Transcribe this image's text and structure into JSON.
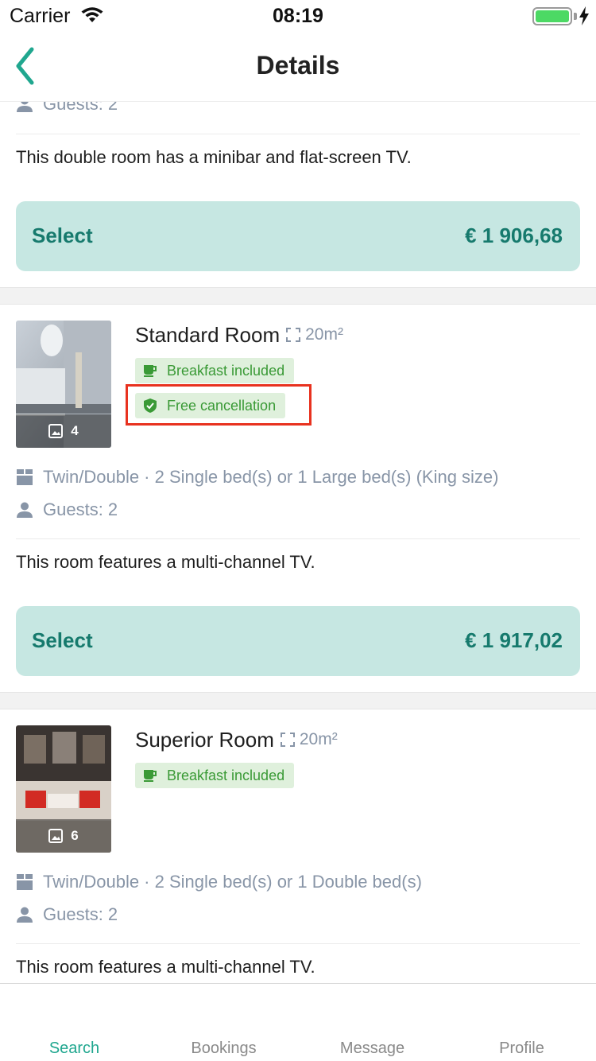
{
  "status_bar": {
    "carrier": "Carrier",
    "time": "08:19"
  },
  "nav": {
    "title": "Details"
  },
  "top_partial": {
    "guests": "Guests: 2",
    "description": "This double room has a minibar and flat-screen TV.",
    "select_label": "Select",
    "price": "€ 1 906,68"
  },
  "rooms": [
    {
      "name": "Standard Room",
      "size": "20m²",
      "photo_count": "4",
      "badges": [
        "Breakfast included",
        "Free cancellation"
      ],
      "beds": "Twin/Double · 2 Single bed(s) or 1 Large bed(s) (King size)",
      "guests": "Guests: 2",
      "description": "This room features a  multi-channel TV.",
      "select_label": "Select",
      "price": "€ 1 917,02"
    },
    {
      "name": "Superior Room",
      "size": "20m²",
      "photo_count": "6",
      "badges": [
        "Breakfast included"
      ],
      "beds": "Twin/Double · 2 Single bed(s) or 1 Double bed(s)",
      "guests": "Guests: 2",
      "description": "This room features a  multi-channel TV."
    }
  ],
  "tabs": [
    {
      "label": "Search",
      "active": true
    },
    {
      "label": "Bookings",
      "active": false
    },
    {
      "label": "Message",
      "active": false
    },
    {
      "label": "Profile",
      "active": false
    }
  ],
  "colors": {
    "accent": "#20a78f",
    "select_bg": "#c6e7e2",
    "select_text": "#167a6d",
    "badge_bg": "#dff0dc",
    "badge_text": "#3a9a36",
    "highlight": "#e8321f",
    "meta_text": "#8895a7"
  },
  "icons": {
    "back": "chevron-left-icon",
    "guests": "person-icon",
    "bed": "bed-grid-icon",
    "size": "expand-icon",
    "photo": "image-icon",
    "breakfast": "coffee-cup-icon",
    "cancellation": "shield-check-icon"
  }
}
